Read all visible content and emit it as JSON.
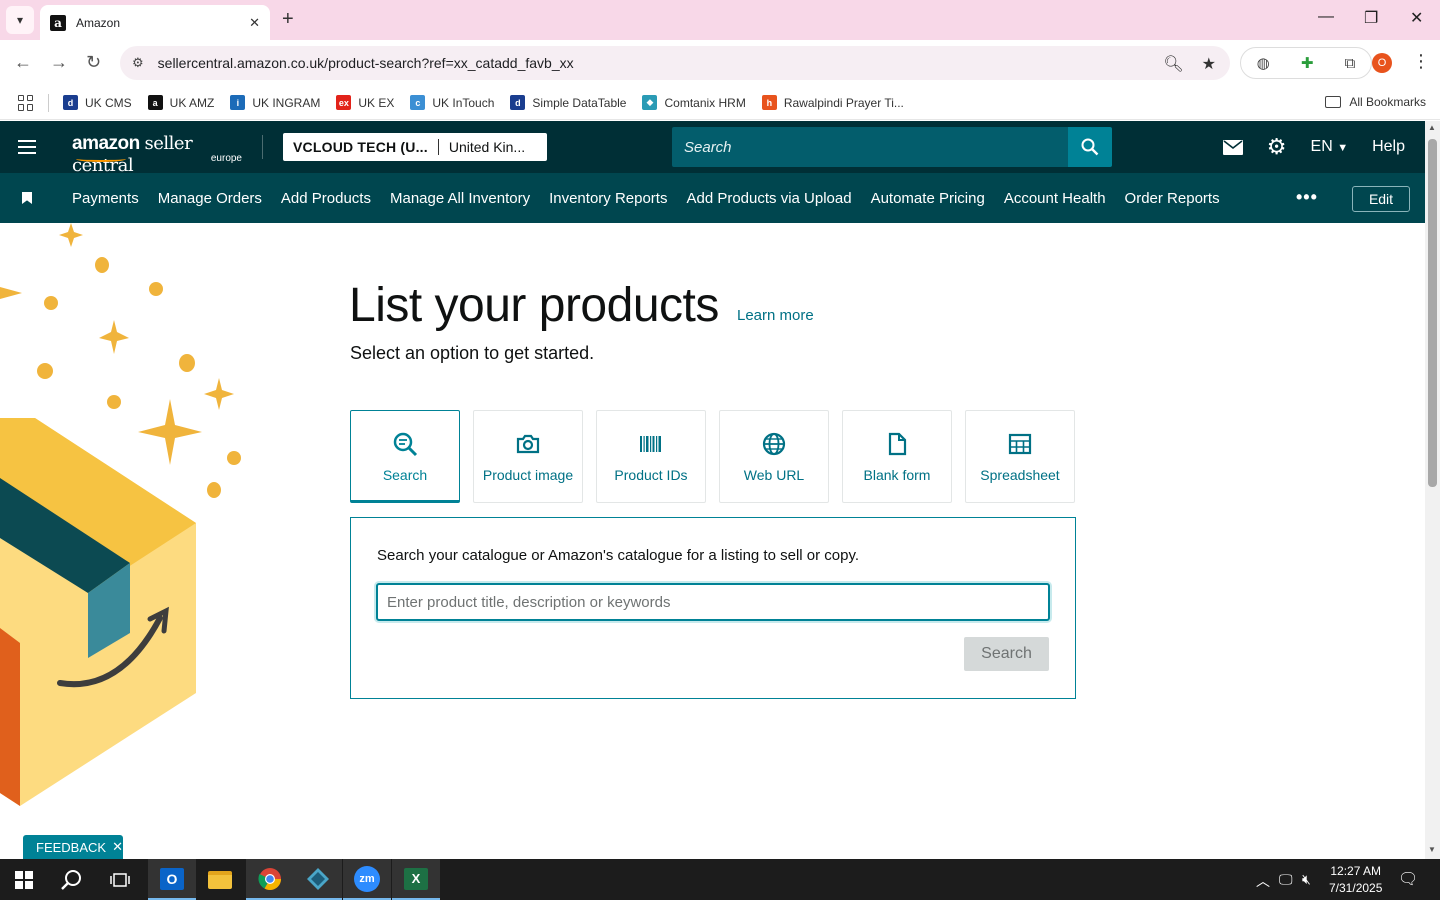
{
  "browser": {
    "tab_title": "Amazon",
    "url": "sellercentral.amazon.co.uk/product-search?ref=xx_catadd_favb_xx",
    "bookmarks": [
      {
        "label": "UK CMS",
        "color": "#1a3d8f",
        "glyph": "d"
      },
      {
        "label": "UK AMZ",
        "color": "#111111",
        "glyph": "a"
      },
      {
        "label": "UK INGRAM",
        "color": "#1c6bb8",
        "glyph": "i"
      },
      {
        "label": "UK EX",
        "color": "#e2231a",
        "glyph": "ex"
      },
      {
        "label": "UK InTouch",
        "color": "#3b8fd4",
        "glyph": "c"
      },
      {
        "label": "Simple DataTable",
        "color": "#1a3d8f",
        "glyph": "d"
      },
      {
        "label": "Comtanix HRM",
        "color": "#2a9bb5",
        "glyph": "◆"
      },
      {
        "label": "Rawalpindi Prayer Ti...",
        "color": "#e8531d",
        "glyph": "h"
      }
    ],
    "all_bookmarks": "All Bookmarks",
    "profile_initial": "O"
  },
  "header": {
    "logo_main": "amazon",
    "logo_sub": "seller central",
    "logo_region": "europe",
    "merchant_name": "VCLOUD TECH (U...",
    "marketplace": "United Kin...",
    "search_placeholder": "Search",
    "language": "EN",
    "help": "Help"
  },
  "nav": {
    "items": [
      "Payments",
      "Manage Orders",
      "Add Products",
      "Manage All Inventory",
      "Inventory Reports",
      "Add Products via Upload",
      "Automate Pricing",
      "Account Health",
      "Order Reports"
    ],
    "more": "•••",
    "edit": "Edit"
  },
  "main": {
    "title": "List your products",
    "learn_more": "Learn more",
    "subtitle": "Select an option to get started.",
    "options": [
      {
        "label": "Search",
        "icon": "search-icon",
        "selected": true
      },
      {
        "label": "Product image",
        "icon": "camera-icon",
        "selected": false
      },
      {
        "label": "Product IDs",
        "icon": "barcode-icon",
        "selected": false
      },
      {
        "label": "Web URL",
        "icon": "globe-icon",
        "selected": false
      },
      {
        "label": "Blank form",
        "icon": "document-icon",
        "selected": false
      },
      {
        "label": "Spreadsheet",
        "icon": "spreadsheet-icon",
        "selected": false
      }
    ],
    "panel_description": "Search your catalogue or Amazon's catalogue for a listing to sell or copy.",
    "input_placeholder": "Enter product title, description or keywords",
    "input_value": "",
    "search_button": "Search"
  },
  "feedback": "FEEDBACK",
  "taskbar": {
    "time": "12:27 AM",
    "date": "7/31/2025"
  },
  "colors": {
    "header_bg": "#002f36",
    "nav_bg": "#00464f",
    "accent": "#008296",
    "link": "#007185"
  }
}
